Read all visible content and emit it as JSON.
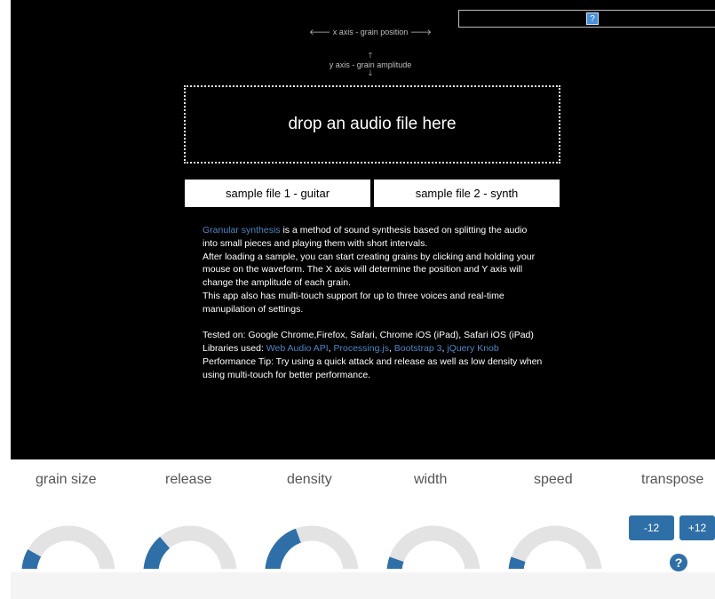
{
  "hints": {
    "x_axis": "🡐 x axis - grain position 🡒",
    "y_axis": "y axis - grain amplitude",
    "up_arrow": "🡑",
    "down_arrow": "🡓"
  },
  "help_box": {
    "icon_label": "?"
  },
  "dropzone": {
    "label": "drop an audio file here"
  },
  "samples": [
    {
      "label": "sample file 1 - guitar"
    },
    {
      "label": "sample file 2 - synth"
    }
  ],
  "description": {
    "p1_link": "Granular synthesis",
    "p1_text": " is a method of sound synthesis based on splitting the audio into small pieces and playing them with short intervals.",
    "p2": "After loading a sample, you can start creating grains by clicking and holding your mouse on the waveform. The X axis will determine the position and Y axis will change the amplitude of each grain.",
    "p3": "This app also has multi-touch support for up to three voices and real-time manupilation of settings.",
    "tested": "Tested on: Google Chrome,Firefox, Safari, Chrome iOS (iPad), Safari iOS (iPad)",
    "libs_prefix": "Libraries used: ",
    "libs": [
      "Web Audio API",
      "Processing.js",
      "Bootstrap 3",
      "jQuery Knob"
    ],
    "tip": "Performance Tip: Try using a quick attack and release as well as low density when using multi-touch for better performance."
  },
  "controls": {
    "labels": [
      "grain size",
      "release",
      "density",
      "width",
      "speed",
      "transpose"
    ],
    "knobs": [
      {
        "name": "grain-size",
        "value": 0.2
      },
      {
        "name": "release",
        "value": 0.3
      },
      {
        "name": "density",
        "value": 0.4
      },
      {
        "name": "width",
        "value": 0.15
      },
      {
        "name": "speed",
        "value": 0.15
      }
    ],
    "transpose_buttons": [
      "-12",
      "+12"
    ],
    "help_label": "?"
  },
  "colors": {
    "accent": "#2f6fa8",
    "track": "#e3e3e3",
    "stage": "#000000",
    "link": "#4a87c5"
  }
}
